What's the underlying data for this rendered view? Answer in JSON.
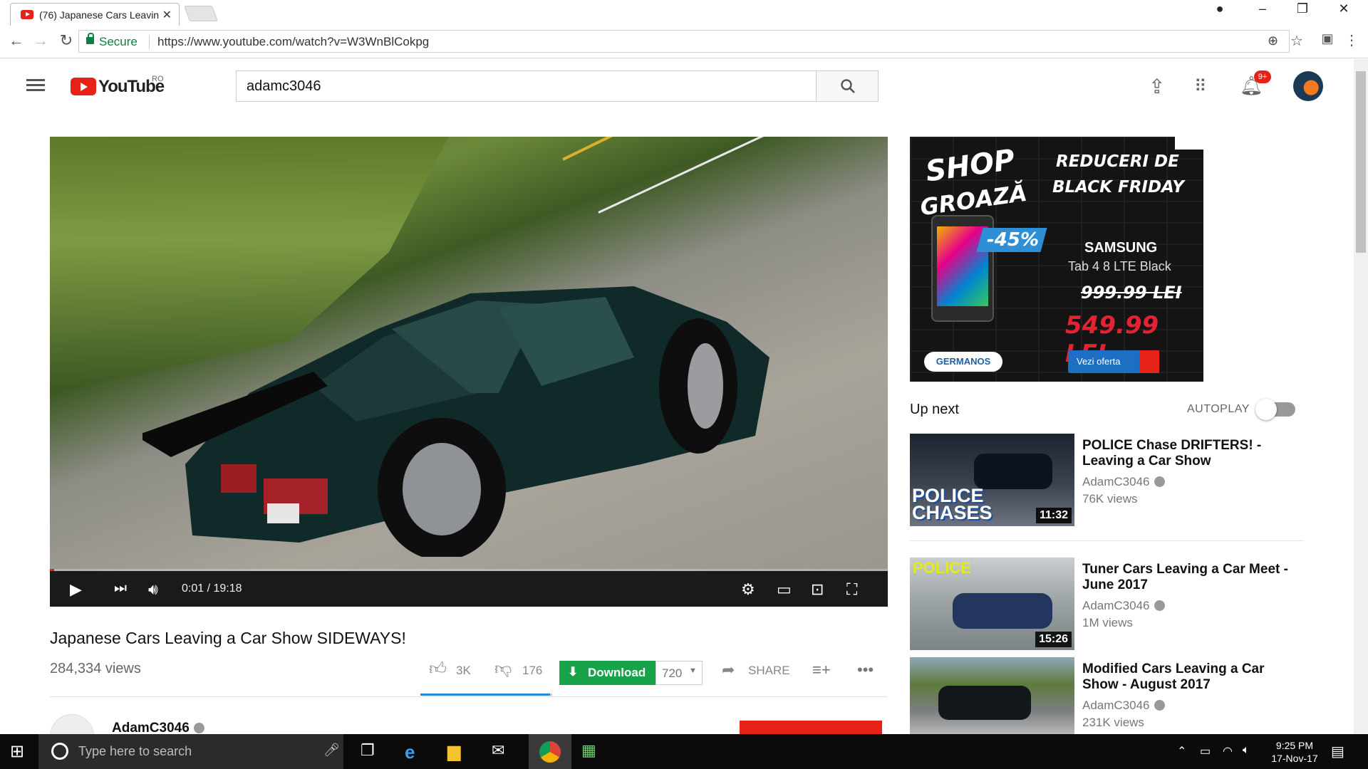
{
  "browser": {
    "tab_title": "(76) Japanese Cars Leavin",
    "secure_label": "Secure",
    "url": "https://www.youtube.com/watch?v=W3WnBlCokpg"
  },
  "header": {
    "logo": "YouTube",
    "region": "RO",
    "search_value": "adamc3046",
    "notif_count": "9+"
  },
  "player": {
    "time": "0:01 / 19:18"
  },
  "video": {
    "title": "Japanese Cars Leaving a Car Show SIDEWAYS!",
    "views": "284,334 views",
    "likes": "3K",
    "dislikes": "176",
    "download_label": "Download",
    "quality": "720",
    "share_label": "SHARE",
    "channel": "AdamC3046"
  },
  "ad": {
    "line1": "SHOP",
    "line2": "GROAZĂ",
    "line3": "REDUCERI DE",
    "line4": "BLACK FRIDAY",
    "discount": "-45%",
    "brand": "SAMSUNG",
    "product": "Tab 4 8 LTE Black",
    "old_price": "999.99 LEI",
    "new_price": "549.99 LEI",
    "store": "GERMANOS",
    "cta": "Vezi oferta"
  },
  "sidebar": {
    "up_next": "Up next",
    "autoplay": "AUTOPLAY",
    "items": [
      {
        "title": "POLICE Chase DRIFTERS! - Leaving a Car Show",
        "channel": "AdamC3046",
        "views": "76K views",
        "duration": "11:32",
        "thumb_text": "POLICE CHASES"
      },
      {
        "title": "Tuner Cars Leaving a Car Meet - June 2017",
        "channel": "AdamC3046",
        "views": "1M views",
        "duration": "15:26",
        "thumb_text": "POLICE"
      },
      {
        "title": "Modified Cars Leaving a Car Show - August 2017",
        "channel": "AdamC3046",
        "views": "231K views",
        "duration": "",
        "thumb_text": ""
      }
    ]
  },
  "taskbar": {
    "search_placeholder": "Type here to search",
    "time": "9:25 PM",
    "date": "17-Nov-17"
  }
}
